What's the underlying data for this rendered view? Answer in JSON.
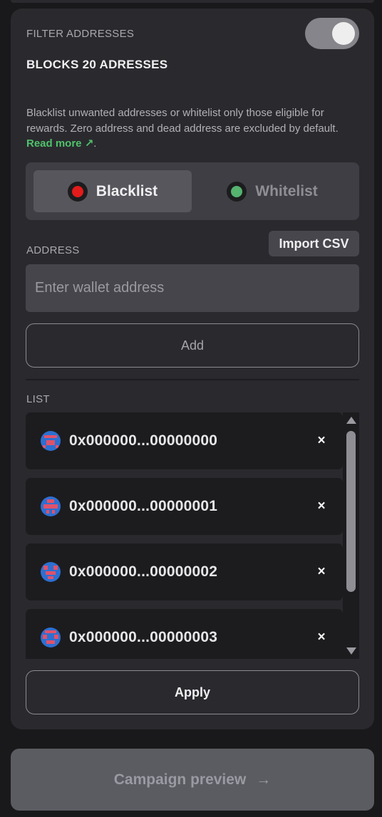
{
  "filter": {
    "section_label": "FILTER ADDRESSES",
    "toggle_on": true,
    "blocks_title": "BLOCKS 20 ADRESSES",
    "description": "Blacklist unwanted addresses or whitelist only those eligible for rewards. Zero address and dead address are excluded by default.",
    "read_more_label": "Read more",
    "read_more_icon": "↗",
    "read_more_trailing": "."
  },
  "mode": {
    "options": [
      {
        "label": "Blacklist",
        "dot_color": "#e21b1b",
        "selected": true
      },
      {
        "label": "Whitelist",
        "dot_color": "#55b26f",
        "selected": false
      }
    ]
  },
  "address": {
    "label": "ADDRESS",
    "import_label": "Import CSV",
    "placeholder": "Enter wallet address",
    "value": "",
    "add_label": "Add"
  },
  "list": {
    "label": "LIST",
    "items": [
      {
        "address": "0x000000...00000000",
        "remove_icon": "×"
      },
      {
        "address": "0x000000...00000001",
        "remove_icon": "×"
      },
      {
        "address": "0x000000...00000002",
        "remove_icon": "×"
      },
      {
        "address": "0x000000...00000003",
        "remove_icon": "×"
      }
    ]
  },
  "apply_label": "Apply",
  "preview": {
    "label": "Campaign preview",
    "arrow": "→"
  }
}
